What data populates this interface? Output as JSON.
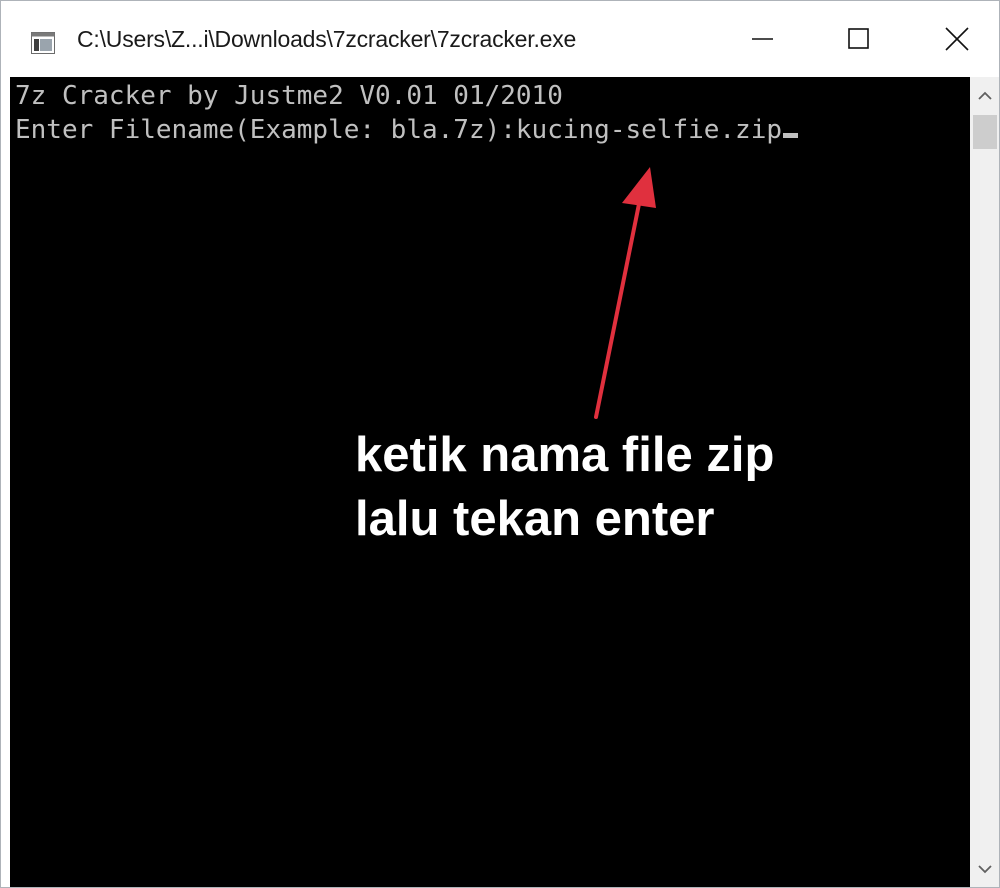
{
  "window": {
    "title": "C:\\Users\\Z...i\\Downloads\\7zcracker\\7zcracker.exe",
    "icon": "console-app-icon",
    "controls": {
      "minimize_icon": "minimize-icon",
      "maximize_icon": "maximize-icon",
      "close_icon": "close-icon"
    }
  },
  "console": {
    "lines": [
      "7z Cracker by Justme2 V0.01 01/2010",
      "Enter Filename(Example: bla.7z):kucing-selfie.zip"
    ],
    "text_color": "#c0c0c0",
    "background": "#000000"
  },
  "annotation": {
    "line1": "ketik nama file zip",
    "line2": "lalu tekan enter",
    "arrow_color": "#e0303e"
  },
  "scrollbar": {
    "up_icon": "chevron-up-icon",
    "down_icon": "chevron-down-icon"
  }
}
